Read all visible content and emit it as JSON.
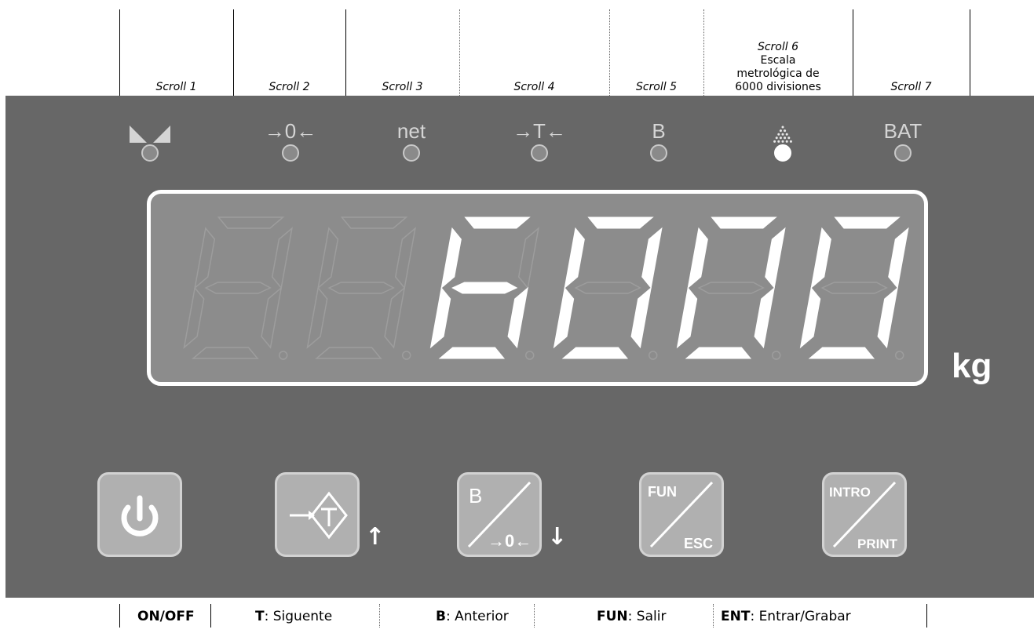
{
  "top_labels": [
    {
      "title": "Scroll 1"
    },
    {
      "title": "Scroll 2"
    },
    {
      "title": "Scroll 3"
    },
    {
      "title": "Scroll 4"
    },
    {
      "title": "Scroll 5"
    },
    {
      "title": "Scroll 6",
      "lines": [
        "Escala",
        "metrológica de",
        "6000 divisiones"
      ]
    },
    {
      "title": "Scroll 7"
    }
  ],
  "indicators": [
    {
      "label": "",
      "icon": "stable-triangles-icon",
      "on": false
    },
    {
      "label": "→0←",
      "icon": "zero-icon",
      "on": false
    },
    {
      "label": "net",
      "icon": "net-icon",
      "on": false
    },
    {
      "label": "→T←",
      "icon": "tare-icon",
      "on": false
    },
    {
      "label": "B",
      "icon": "gross-icon",
      "on": false
    },
    {
      "label": "",
      "icon": "dotted-triangle-icon",
      "on": true
    },
    {
      "label": "BAT",
      "icon": "battery-icon",
      "on": false
    }
  ],
  "display": {
    "value": "6000",
    "digits": 6,
    "unit": "kg"
  },
  "keys": [
    {
      "name": "power-key",
      "icon": "power-icon"
    },
    {
      "name": "tare-key",
      "icon": "tare-key-icon",
      "arrow": "↑"
    },
    {
      "name": "gross-zero-key",
      "icon": "gross-zero-icon",
      "arrow": "↓"
    },
    {
      "name": "fun-esc-key",
      "icon": "fun-esc-icon",
      "top": "FUN",
      "bottom": "ESC"
    },
    {
      "name": "intro-print-key",
      "icon": "intro-print-icon",
      "top": "INTRO",
      "bottom": "PRINT"
    }
  ],
  "key_text": {
    "gross": "B",
    "zero": "→0←"
  },
  "bottom_labels": [
    {
      "key": "",
      "desc": "ON/OFF"
    },
    {
      "key": "T",
      "desc": ": Siguente"
    },
    {
      "key": "B",
      "desc": ": Anterior"
    },
    {
      "key": "FUN",
      "desc": ": Salir"
    },
    {
      "key": "ENT",
      "desc": ": Entrar/Grabar"
    }
  ],
  "colors": {
    "panel": "#676767",
    "display": "#8c8c8c",
    "segment_on": "#ffffff",
    "segment_off": "#9d9d9d",
    "key": "#b0b0b0"
  }
}
